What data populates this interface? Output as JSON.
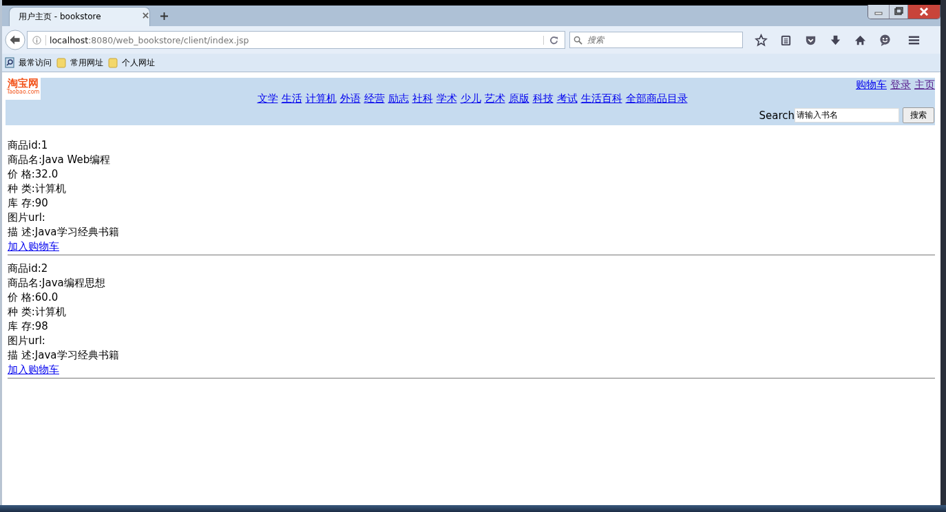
{
  "browser": {
    "tab": {
      "title": "用户主页 - bookstore",
      "selected": true
    },
    "address": {
      "host": "localhost",
      "path": ":8080/web_bookstore/client/index.jsp"
    },
    "search": {
      "placeholder": "搜索"
    },
    "bookmarks": [
      {
        "label": "最常访问",
        "kind": "special"
      },
      {
        "label": "常用网址",
        "kind": "folder"
      },
      {
        "label": "个人网址",
        "kind": "folder"
      }
    ]
  },
  "header": {
    "logo": {
      "title": "淘宝网",
      "subtitle": "Taobao.com"
    },
    "user_links": [
      {
        "label": "购物车",
        "visited": false
      },
      {
        "label": "登录",
        "visited": true
      },
      {
        "label": "主页",
        "visited": true
      }
    ],
    "categories": [
      "文学",
      "生活",
      "计算机",
      "外语",
      "经营",
      "励志",
      "社科",
      "学术",
      "少儿",
      "艺术",
      "原版",
      "科技",
      "考试",
      "生活百科",
      "全部商品目录"
    ],
    "search": {
      "label": "Search",
      "value": "请输入书名",
      "button": "搜索"
    }
  },
  "products": [
    {
      "lines": [
        "商品id:1",
        "商品名:Java Web编程",
        "价 格:32.0",
        "种 类:计算机",
        "库 存:90",
        "图片url:",
        "描 述:Java学习经典书籍"
      ],
      "link": "加入购物车"
    },
    {
      "lines": [
        "商品id:2",
        "商品名:Java编程思想",
        "价 格:60.0",
        "种 类:计算机",
        "库 存:98",
        "图片url:",
        "描 述:Java学习经典书籍"
      ],
      "link": "加入购物车"
    }
  ]
}
